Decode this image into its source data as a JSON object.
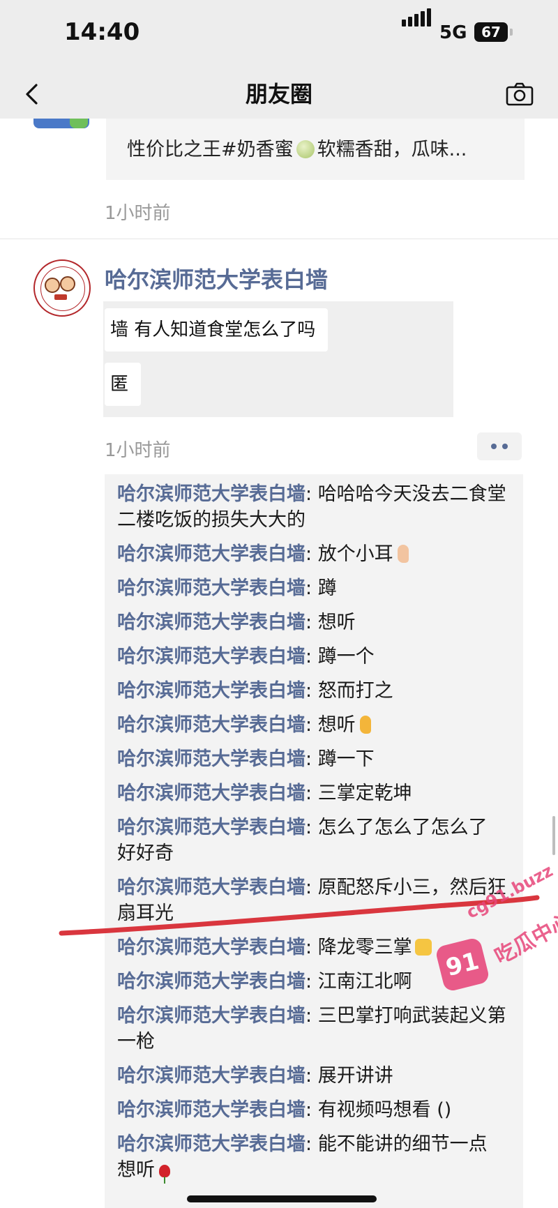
{
  "status": {
    "time": "14:40",
    "network": "5G",
    "battery": "67"
  },
  "nav": {
    "title": "朋友圈"
  },
  "posts": [
    {
      "link_text": "性价比之王#奶香蜜",
      "link_text_tail": "软糯香甜，瓜味...",
      "time": "1小时前"
    },
    {
      "author": "哈尔滨师范大学表白墙",
      "lines": [
        "墙 有人知道食堂怎么了吗",
        "匿"
      ],
      "time": "1小时前"
    }
  ],
  "comments": [
    {
      "name": "哈尔滨师范大学表白墙",
      "sep": ": ",
      "text": "哈哈哈今天没去二食堂二楼吃饭的损失大大的"
    },
    {
      "name": "哈尔滨师范大学表白墙",
      "sep": ": ",
      "text": "放个小耳"
    },
    {
      "name": "哈尔滨师范大学表白墙",
      "sep": ": ",
      "text": "蹲"
    },
    {
      "name": "哈尔滨师范大学表白墙",
      "sep": ": ",
      "text": "想听"
    },
    {
      "name": "哈尔滨师范大学表白墙",
      "sep": ": ",
      "text": "蹲一个"
    },
    {
      "name": "哈尔滨师范大学表白墙",
      "sep": ": ",
      "text": "怒而打之"
    },
    {
      "name": "哈尔滨师范大学表白墙",
      "sep": ": ",
      "text": "想听"
    },
    {
      "name": "哈尔滨师范大学表白墙",
      "sep": ": ",
      "text": "蹲一下"
    },
    {
      "name": "哈尔滨师范大学表白墙",
      "sep": ": ",
      "text": "三掌定乾坤"
    },
    {
      "name": "哈尔滨师范大学表白墙",
      "sep": ": ",
      "text": "怎么了怎么了怎么了 好好奇"
    },
    {
      "name": "哈尔滨师范大学表白墙",
      "sep": ": ",
      "text": "原配怒斥小三，然后狂扇耳光"
    },
    {
      "name": "哈尔滨师范大学表白墙",
      "sep": ": ",
      "text": "降龙零三掌"
    },
    {
      "name": "哈尔滨师范大学表白墙",
      "sep": ": ",
      "text": "江南江北啊"
    },
    {
      "name": "哈尔滨师范大学表白墙",
      "sep": ": ",
      "text": "三巴掌打响武装起义第一枪"
    },
    {
      "name": "哈尔滨师范大学表白墙",
      "sep": ": ",
      "text": "展开讲讲"
    },
    {
      "name": "哈尔滨师范大学表白墙",
      "sep": ": ",
      "text": "有视频吗想看 ()"
    },
    {
      "name": "哈尔滨师范大学表白墙",
      "sep": ": ",
      "text": "能不能讲的细节一点 想听"
    }
  ],
  "watermark": {
    "badge": "91",
    "domain": "cg91.buzz",
    "text": "吃瓜中心"
  },
  "icons": {
    "back": "chevron-left-icon",
    "camera": "camera-icon",
    "more": "more-dots-icon",
    "emoji_melon": "melon-emoji",
    "emoji_ear": "ear-emoji",
    "emoji_hand": "raised-hand-emoji",
    "emoji_rose": "rose-emoji"
  },
  "colors": {
    "link_blue": "#576b95",
    "annotation_red": "#d9363e",
    "watermark_pink": "#e7467a",
    "bar_gray": "#ededed"
  }
}
